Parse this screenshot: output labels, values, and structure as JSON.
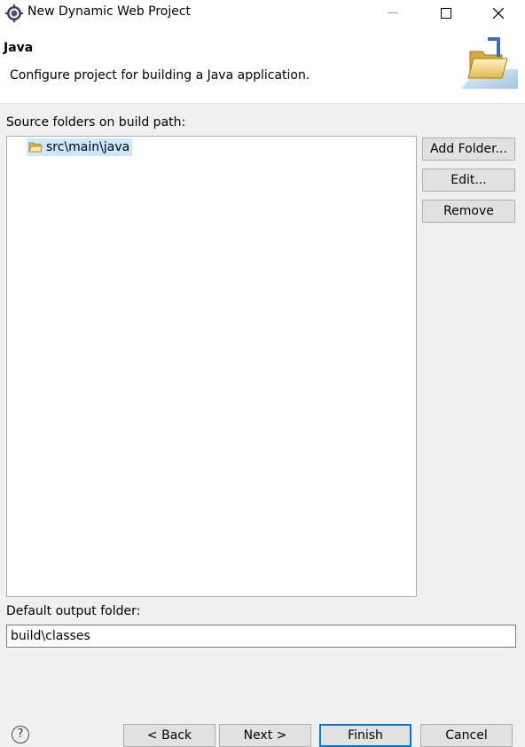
{
  "window": {
    "title": "New Dynamic Web Project",
    "icons": {
      "app": "eclipse-gear-icon",
      "minimize": "minimize-icon",
      "maximize": "maximize-icon",
      "close": "close-icon"
    }
  },
  "header": {
    "title": "Java",
    "description": "Configure project for building a Java application.",
    "icon": "folder-banner-icon"
  },
  "source_folders": {
    "label": "Source folders on build path:",
    "items": [
      {
        "label": "src\\main\\java",
        "icon": "source-folder-icon",
        "selected": true
      }
    ],
    "buttons": {
      "add": "Add Folder...",
      "edit": "Edit...",
      "remove": "Remove"
    }
  },
  "output": {
    "label": "Default output folder:",
    "value": "build\\classes"
  },
  "footer": {
    "help": "?",
    "back": "< Back",
    "next": "Next >",
    "finish": "Finish",
    "cancel": "Cancel"
  },
  "colors": {
    "selection": "#cce8ff",
    "accent": "#0078d7",
    "button": "#e1e1e1",
    "background": "#f0f0f0"
  }
}
